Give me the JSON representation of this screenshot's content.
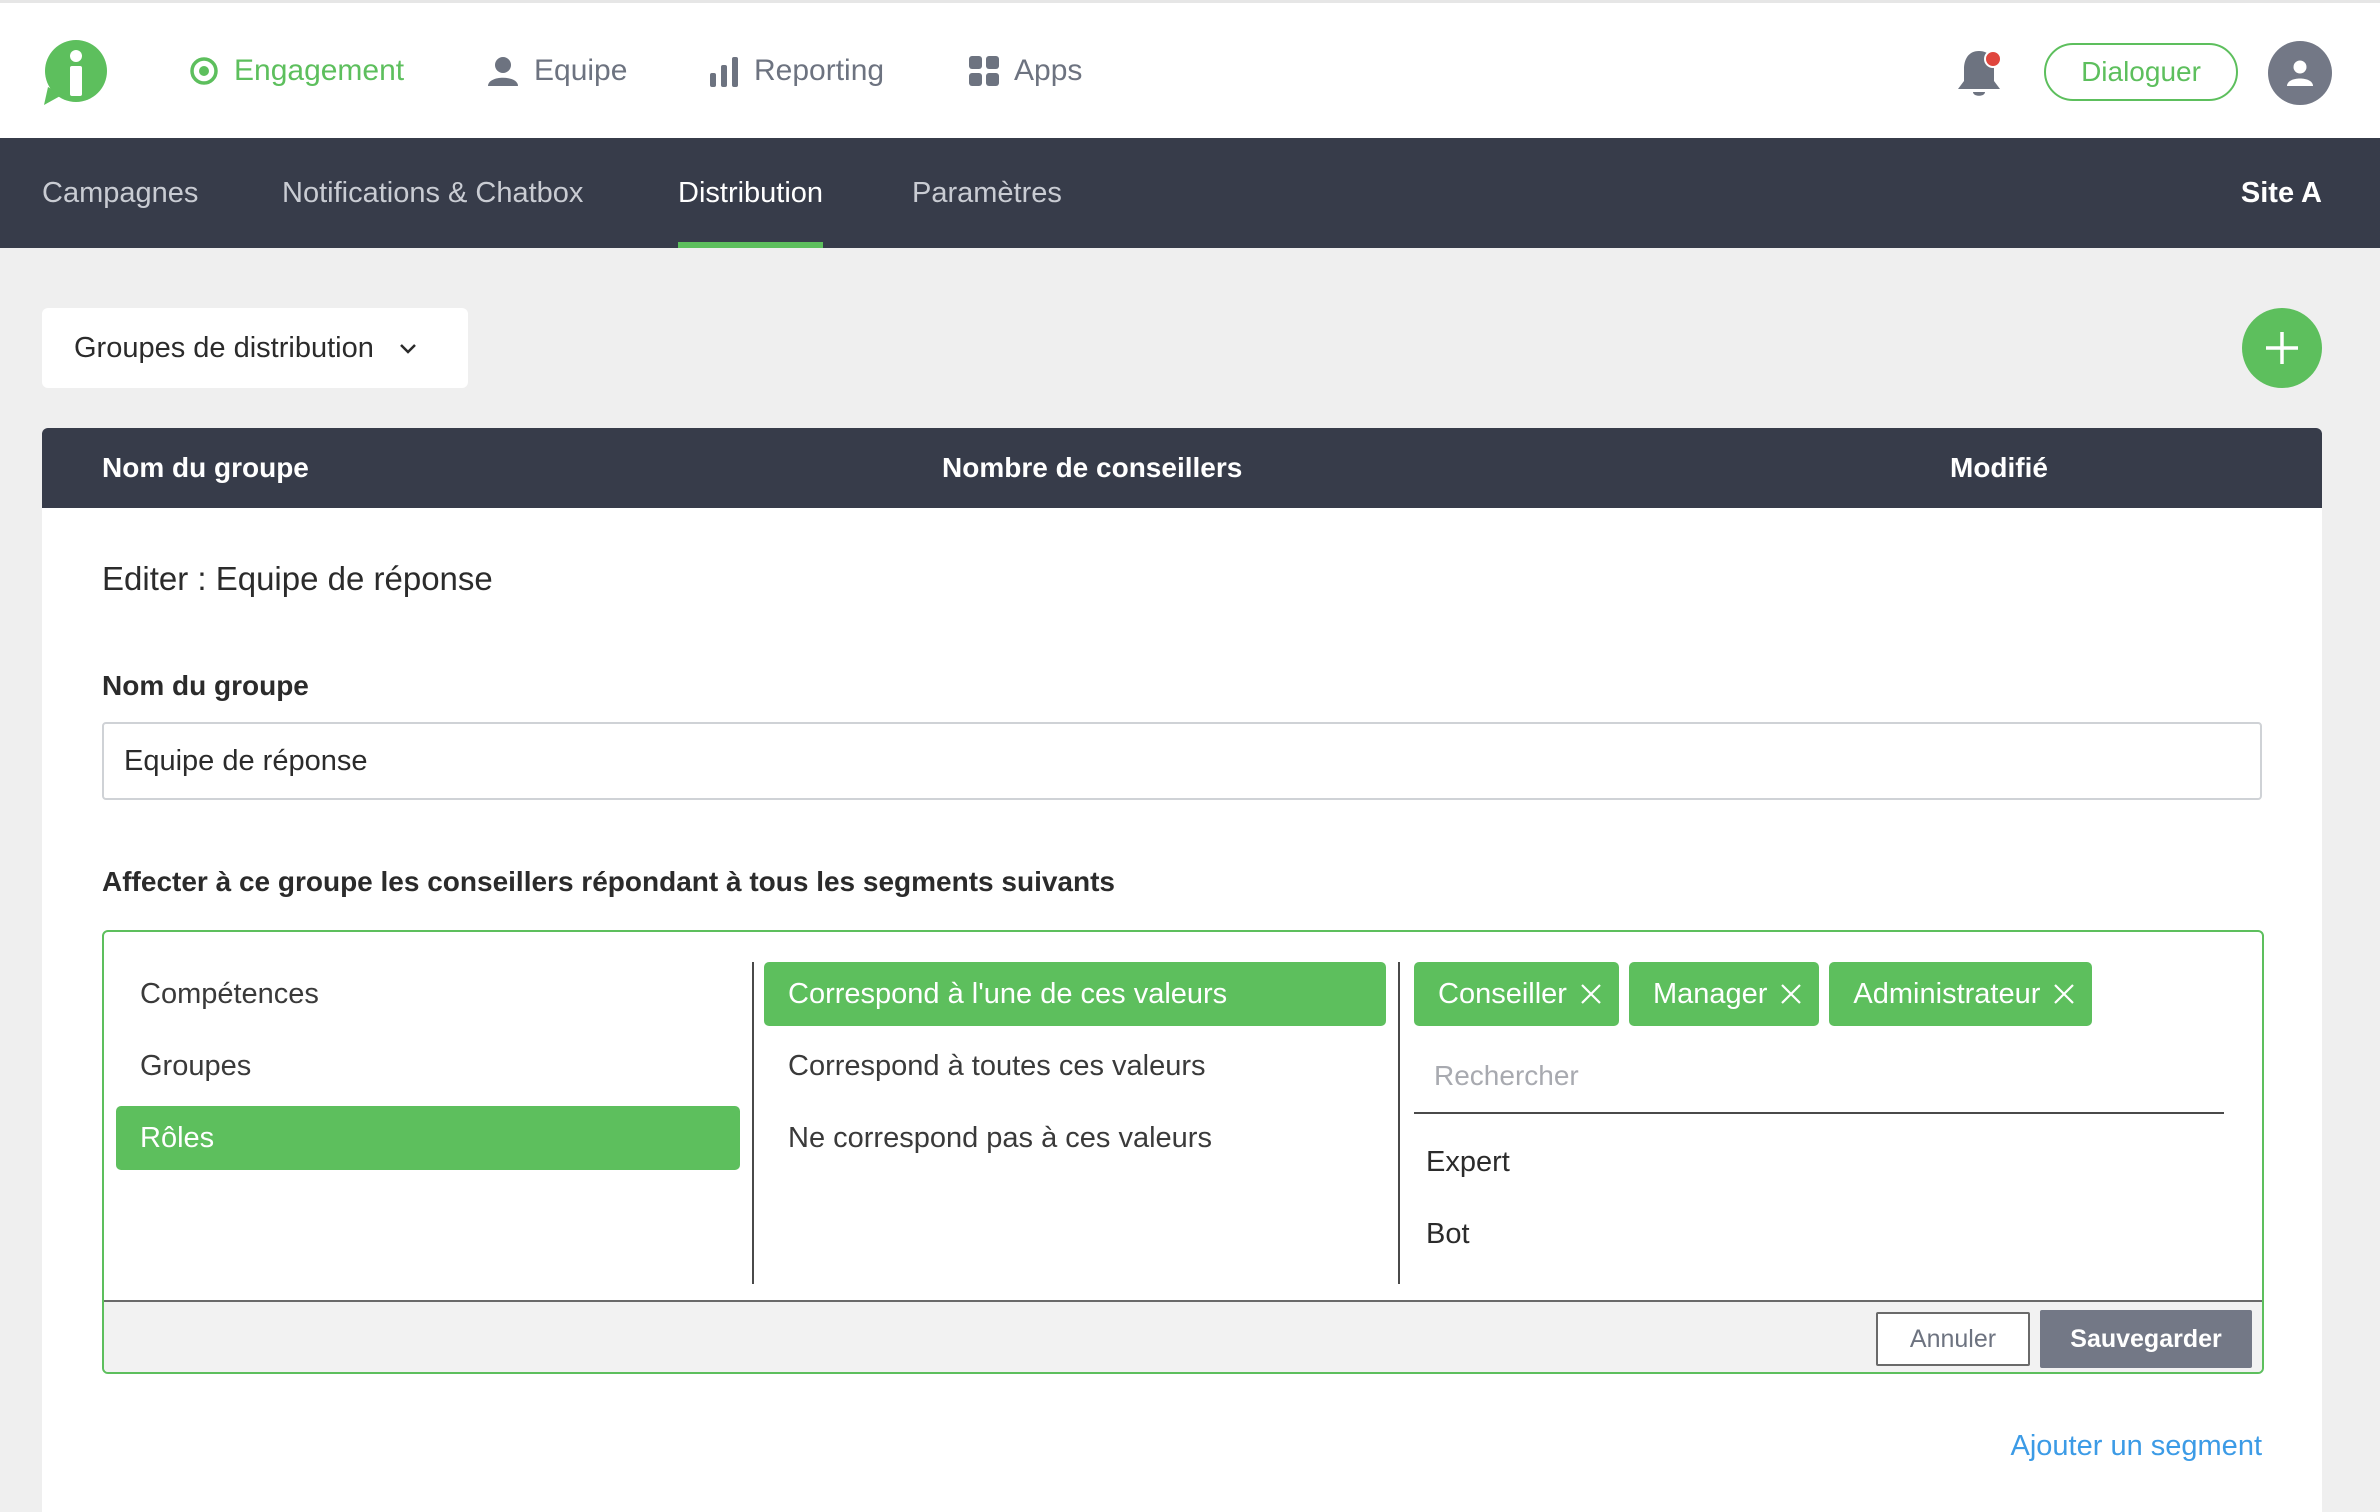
{
  "topnav": {
    "items": [
      {
        "label": "Engagement",
        "icon": "target-icon",
        "active": true
      },
      {
        "label": "Equipe",
        "icon": "user-icon",
        "active": false
      },
      {
        "label": "Reporting",
        "icon": "bar-chart-icon",
        "active": false
      },
      {
        "label": "Apps",
        "icon": "grid-icon",
        "active": false
      }
    ],
    "dialoguer_label": "Dialoguer"
  },
  "subnav": {
    "items": [
      {
        "label": "Campagnes",
        "active": false
      },
      {
        "label": "Notifications & Chatbox",
        "active": false
      },
      {
        "label": "Distribution",
        "active": true
      },
      {
        "label": "Paramètres",
        "active": false
      }
    ],
    "site": "Site A"
  },
  "dropdown": {
    "label": "Groupes de distribution"
  },
  "table": {
    "headers": [
      "Nom du groupe",
      "Nombre de conseillers",
      "Modifié"
    ]
  },
  "editor": {
    "title": "Editer : Equipe de réponse",
    "name_label": "Nom du groupe",
    "name_value": "Equipe de réponse",
    "segment_label": "Affecter à ce groupe les conseillers répondant à tous les segments suivants",
    "categories": [
      "Compétences",
      "Groupes",
      "Rôles"
    ],
    "selected_category": "Rôles",
    "match_options": [
      "Correspond à l'une de ces valeurs",
      "Correspond à toutes ces valeurs",
      "Ne correspond pas à ces valeurs"
    ],
    "selected_match": "Correspond à l'une de ces valeurs",
    "tags": [
      "Conseiller",
      "Manager",
      "Administrateur"
    ],
    "search_placeholder": "Rechercher",
    "choices": [
      "Expert",
      "Bot"
    ],
    "cancel_label": "Annuler",
    "save_label": "Sauvegarder",
    "add_segment_label": "Ajouter un segment"
  },
  "colors": {
    "accent": "#5dbf5d",
    "navbar_dark": "#373c4a",
    "link": "#3c9be6",
    "notification_dot": "#e0463e"
  }
}
